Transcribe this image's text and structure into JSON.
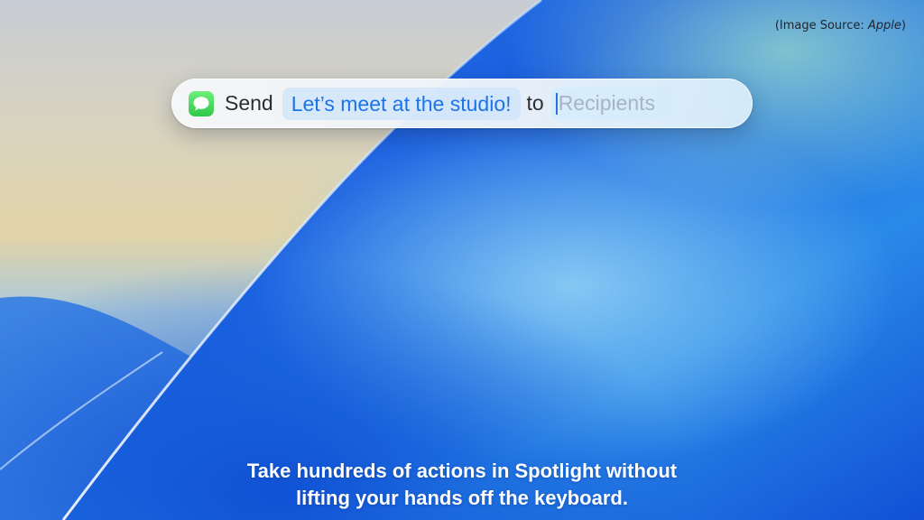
{
  "credit": {
    "prefix": "(Image Source: ",
    "source": "Apple",
    "suffix": ")"
  },
  "spotlight": {
    "app_icon": "messages-icon",
    "verb": "Send",
    "message": "Let’s meet at the studio!",
    "connector": "to",
    "recipients_placeholder": "Recipients"
  },
  "caption": {
    "line1": "Take hundreds of actions in Spotlight without",
    "line2": "lifting your hands off the keyboard."
  },
  "colors": {
    "accent_blue": "#1d74e6",
    "messages_green": "#34c759",
    "wallpaper_blue": "#1358d8"
  }
}
